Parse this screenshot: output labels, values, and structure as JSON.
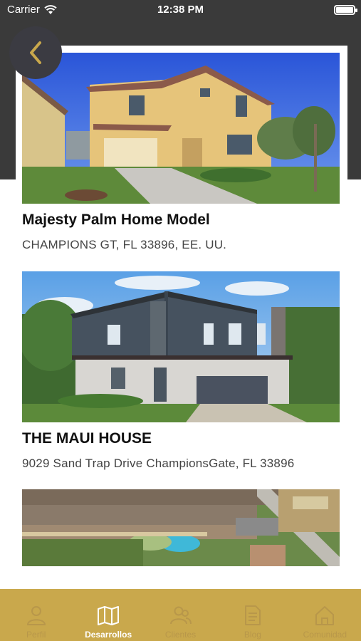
{
  "status_bar": {
    "carrier": "Carrier",
    "time": "12:38 PM"
  },
  "listings": [
    {
      "title": "Majesty Palm Home Model",
      "address": "CHAMPIONS GT, FL 33896, EE. UU."
    },
    {
      "title": "THE MAUI HOUSE",
      "address": "9029 Sand Trap Drive ChampionsGate, FL 33896"
    },
    {
      "title": "",
      "address": ""
    }
  ],
  "tabs": [
    {
      "label": "Perfil",
      "icon": "person-icon",
      "active": false
    },
    {
      "label": "Desarrollos",
      "icon": "map-icon",
      "active": true
    },
    {
      "label": "Clientes",
      "icon": "people-icon",
      "active": false
    },
    {
      "label": "Blog",
      "icon": "document-icon",
      "active": false
    },
    {
      "label": "Comunidad",
      "icon": "house-icon",
      "active": false
    }
  ],
  "colors": {
    "tabbar": "#c9a84c",
    "header": "#3a3a3a",
    "back_button": "#3b3b42",
    "chevron": "#c9a84c"
  }
}
